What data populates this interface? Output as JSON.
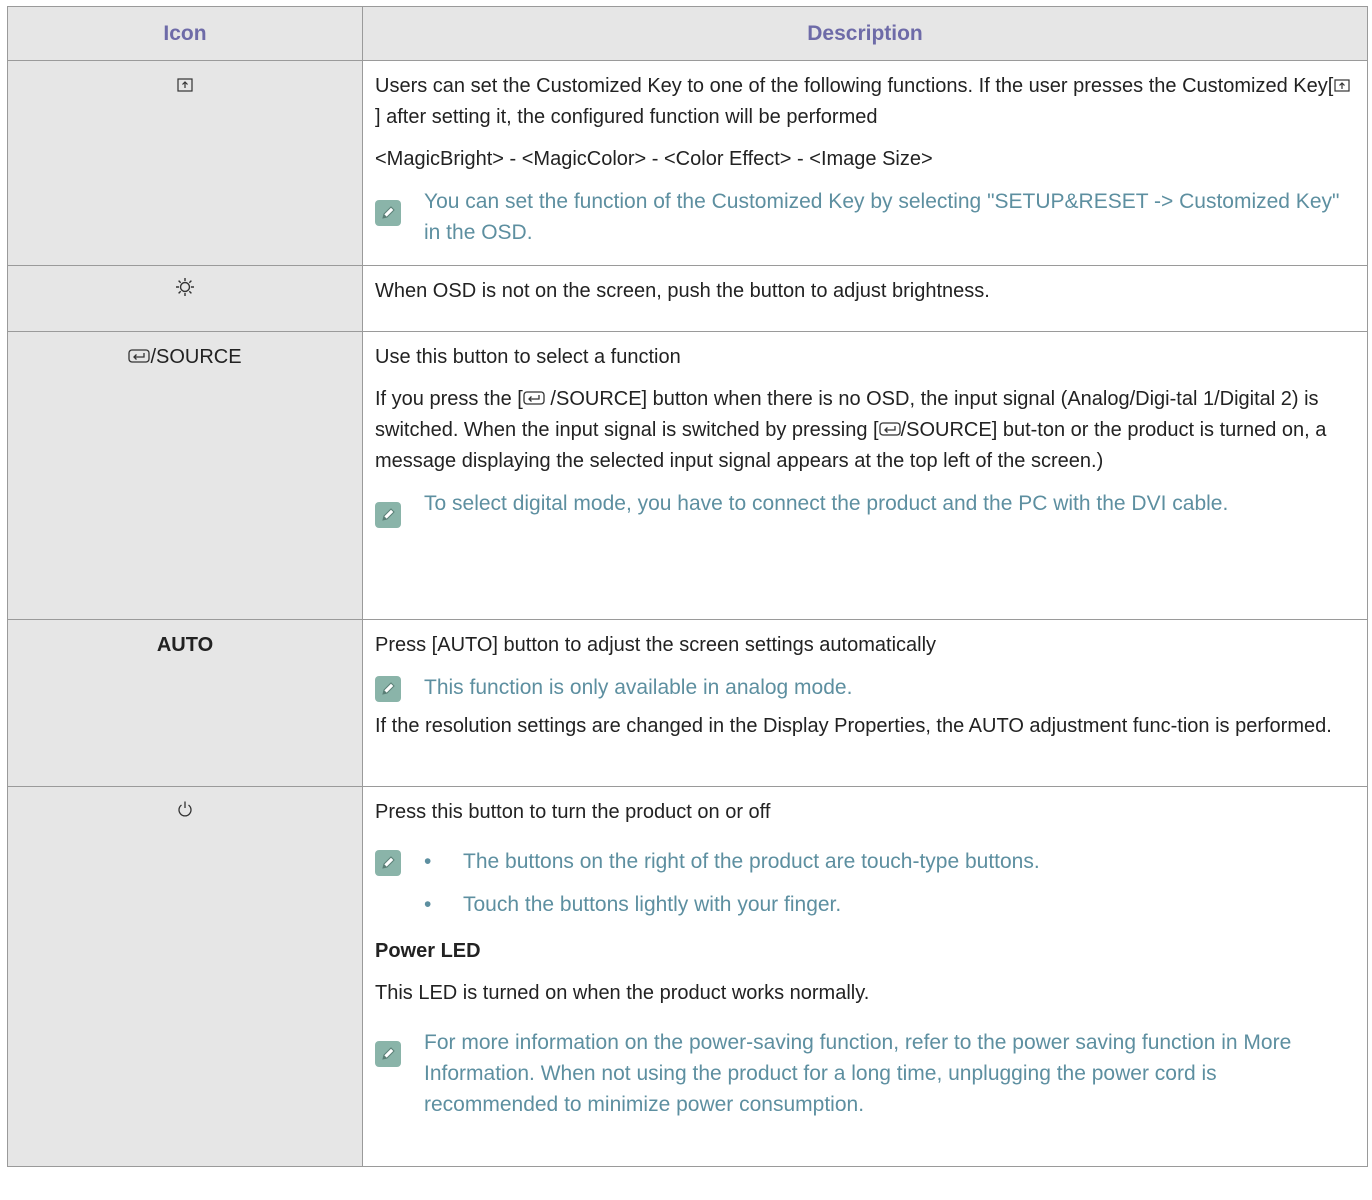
{
  "table": {
    "header_icon": "Icon",
    "header_description": "Description"
  },
  "rows": {
    "customized_key": {
      "icon": "customized-key-icon",
      "desc_line1": "Users can set the Customized Key to one of the following functions. If the user presses the Customized Key[",
      "desc_line1_end": "] after setting it, the configured function will be performed",
      "desc_options": "<MagicBright> - <MagicColor> - <Color Effect> - <Image Size>",
      "note": "You can set the function of the Customized Key by selecting \"SETUP&RESET -> Customized Key\" in the OSD."
    },
    "brightness": {
      "icon": "brightness-icon",
      "desc": "When OSD is not on the screen, push the button to adjust brightness."
    },
    "source": {
      "icon": "enter-icon",
      "label": "/SOURCE",
      "desc_line1": "Use this button to select a function",
      "desc_p2_a": "If you press the [",
      "desc_p2_b": " /SOURCE] button when there is no OSD, the input signal (Analog/Digi-tal 1/Digital 2) is switched. When the input signal is switched by pressing [",
      "desc_p2_c": "/SOURCE] but-ton or the product is turned on, a message displaying the selected input signal appears at the top left of the screen.)",
      "note": "To select digital mode, you have to connect the product and the PC with the DVI cable."
    },
    "auto": {
      "label": "AUTO",
      "desc_line1": "Press [AUTO] button to adjust the screen settings automatically",
      "note": "This function is only available in analog mode.",
      "desc_line2": "If the resolution settings are changed in the Display Properties, the AUTO adjustment func-tion is performed."
    },
    "power": {
      "icon": "power-icon",
      "desc_line1": "Press this button to turn the product on or off",
      "bullets": [
        "The buttons on the right of the product are touch-type buttons.",
        "Touch the buttons lightly with your finger."
      ],
      "led_title": "Power LED",
      "led_desc": "This LED is turned on when the product works normally.",
      "note": "For more information on the power-saving function, refer to the power saving function in More Information. When not using the product for a long time, unplugging the power cord is recommended to minimize power consumption."
    }
  },
  "colors": {
    "header_text": "#6e6ba8",
    "note_text": "#5d8fa0",
    "note_icon_bg": "#8ab4a9",
    "cell_bg": "#e6e6e6"
  }
}
